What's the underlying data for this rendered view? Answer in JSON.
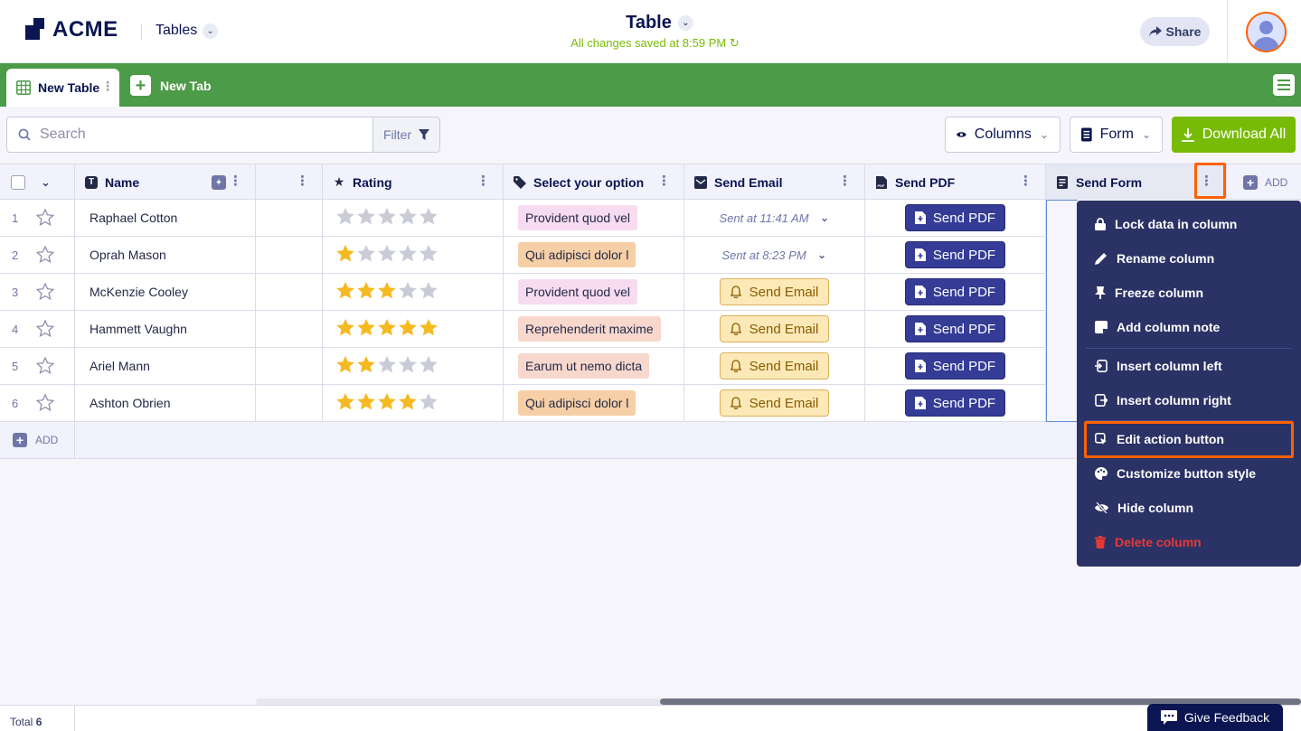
{
  "header": {
    "logo_text": "ACME",
    "tables_label": "Tables",
    "title": "Table",
    "saved_status": "All changes saved at 8:59 PM",
    "share_label": "Share"
  },
  "tabs": {
    "active_label": "New Table",
    "new_tab_label": "New Tab"
  },
  "toolbar": {
    "search_placeholder": "Search",
    "filter_label": "Filter",
    "columns_label": "Columns",
    "form_label": "Form",
    "download_label": "Download All"
  },
  "columns": {
    "name": "Name",
    "rating": "Rating",
    "select": "Select your option",
    "send_email": "Send Email",
    "send_pdf": "Send PDF",
    "send_form": "Send Form",
    "add": "ADD"
  },
  "rows": [
    {
      "num": "1",
      "name": "Raphael Cotton",
      "rating": 0,
      "option": "Provident quod vel",
      "option_color": "#f7dcf1",
      "email": "Sent at 11:41 AM",
      "email_sent": true,
      "pdf": "Send PDF"
    },
    {
      "num": "2",
      "name": "Oprah Mason",
      "rating": 1,
      "option": "Qui adipisci dolor l",
      "option_color": "#f6cfa6",
      "email": "Sent at 8:23 PM",
      "email_sent": true,
      "pdf": "Send PDF"
    },
    {
      "num": "3",
      "name": "McKenzie Cooley",
      "rating": 3,
      "option": "Provident quod vel",
      "option_color": "#f7dcf1",
      "email": "Send Email",
      "email_sent": false,
      "pdf": "Send PDF"
    },
    {
      "num": "4",
      "name": "Hammett Vaughn",
      "rating": 5,
      "option": "Reprehenderit maxime",
      "option_color": "#f8d8cd",
      "email": "Send Email",
      "email_sent": false,
      "pdf": "Send PDF"
    },
    {
      "num": "5",
      "name": "Ariel Mann",
      "rating": 2,
      "option": "Earum ut nemo dicta",
      "option_color": "#f8d8cd",
      "email": "Send Email",
      "email_sent": false,
      "pdf": "Send PDF"
    },
    {
      "num": "6",
      "name": "Ashton Obrien",
      "rating": 4,
      "option": "Qui adipisci dolor l",
      "option_color": "#f6cfa6",
      "email": "Send Email",
      "email_sent": false,
      "pdf": "Send PDF"
    }
  ],
  "add_row_label": "ADD",
  "context_menu": {
    "lock": "Lock data in column",
    "rename": "Rename column",
    "freeze": "Freeze column",
    "note": "Add column note",
    "insert_left": "Insert column left",
    "insert_right": "Insert column right",
    "edit_action": "Edit action button",
    "customize": "Customize button style",
    "hide": "Hide column",
    "delete": "Delete column"
  },
  "footer": {
    "total_label": "Total",
    "total_count": "6",
    "feedback_label": "Give Feedback"
  },
  "colors": {
    "brand_navy": "#0a1551",
    "tab_green": "#4c9b48",
    "download_green": "#78bb07",
    "menu_bg": "#2b3265",
    "highlight_orange": "#ff6100",
    "delete_red": "#e53935",
    "star_filled": "#f5b921",
    "star_empty": "#c9cbd6"
  }
}
